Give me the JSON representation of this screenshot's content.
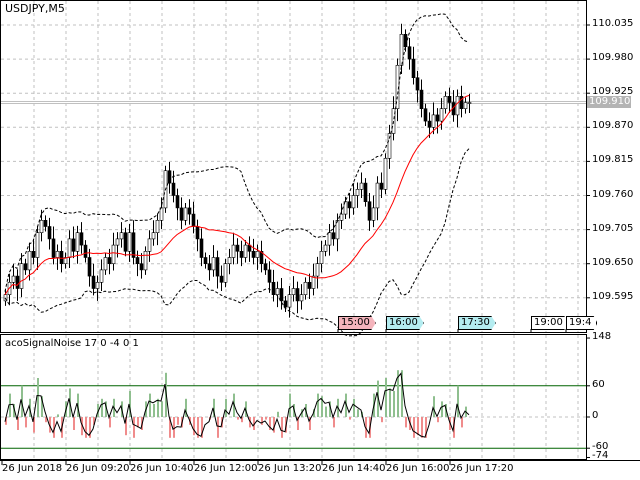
{
  "chart": {
    "symbol_title": "USDJPY,M5",
    "current_price": "109.910",
    "current_price_value": 109.91
  },
  "price_axis": {
    "labels": [
      "110.035",
      "109.980",
      "109.925",
      "109.870",
      "109.815",
      "109.760",
      "109.705",
      "109.650",
      "109.595"
    ],
    "values": [
      110.035,
      109.98,
      109.925,
      109.87,
      109.815,
      109.76,
      109.705,
      109.65,
      109.595
    ]
  },
  "time_axis": [
    "26 Jun 2018",
    "26 Jun 09:20",
    "26 Jun 10:40",
    "26 Jun 12:00",
    "26 Jun 13:20",
    "26 Jun 14:40",
    "26 Jun 16:00",
    "26 Jun 17:20"
  ],
  "session_tags": [
    {
      "label": "15:00",
      "color": "#f4b4bc"
    },
    {
      "label": "16:00",
      "color": "#b4ecf0"
    },
    {
      "label": "17:30",
      "color": "#b4ecf0"
    },
    {
      "label": "19:00",
      "color": "#ffffff"
    },
    {
      "label": "19:4",
      "color": "#ffffff"
    }
  ],
  "indicator": {
    "title": "acoSignalNoise 17 0 -4 0 1",
    "axis_labels": [
      "148",
      "60",
      "0",
      "-60",
      "-74"
    ],
    "axis_values": [
      148,
      60,
      0,
      -60,
      -74
    ],
    "level_lines": [
      60,
      -60
    ],
    "positive_color": "#8fbf8f",
    "negative_color": "#f08c8c"
  },
  "colors": {
    "ma": "#ff0000",
    "bands": "#000000",
    "grid": "#c0c0c0"
  },
  "closes": [
    109.6,
    109.62,
    109.63,
    109.61,
    109.65,
    109.64,
    109.67,
    109.66,
    109.7,
    109.72,
    109.71,
    109.69,
    109.66,
    109.67,
    109.65,
    109.66,
    109.69,
    109.67,
    109.7,
    109.68,
    109.66,
    109.63,
    109.61,
    109.62,
    109.64,
    109.66,
    109.65,
    109.68,
    109.69,
    109.7,
    109.67,
    109.7,
    109.66,
    109.65,
    109.64,
    109.67,
    109.69,
    109.7,
    109.72,
    109.74,
    109.8,
    109.78,
    109.76,
    109.74,
    109.72,
    109.74,
    109.73,
    109.71,
    109.69,
    109.66,
    109.65,
    109.64,
    109.66,
    109.63,
    109.62,
    109.65,
    109.66,
    109.68,
    109.67,
    109.66,
    109.68,
    109.67,
    109.66,
    109.67,
    109.65,
    109.64,
    109.62,
    109.6,
    109.61,
    109.59,
    109.58,
    109.6,
    109.61,
    109.59,
    109.6,
    109.62,
    109.61,
    109.63,
    109.65,
    109.67,
    109.68,
    109.7,
    109.69,
    109.72,
    109.73,
    109.75,
    109.74,
    109.76,
    109.77,
    109.78,
    109.75,
    109.72,
    109.74,
    109.78,
    109.77,
    109.82,
    109.86,
    109.9,
    109.97,
    110.02,
    110.0,
    109.98,
    109.95,
    109.93,
    109.9,
    109.88,
    109.87,
    109.89,
    109.88,
    109.9,
    109.92,
    109.91,
    109.89,
    109.92,
    109.9,
    109.91,
    109.91
  ]
}
